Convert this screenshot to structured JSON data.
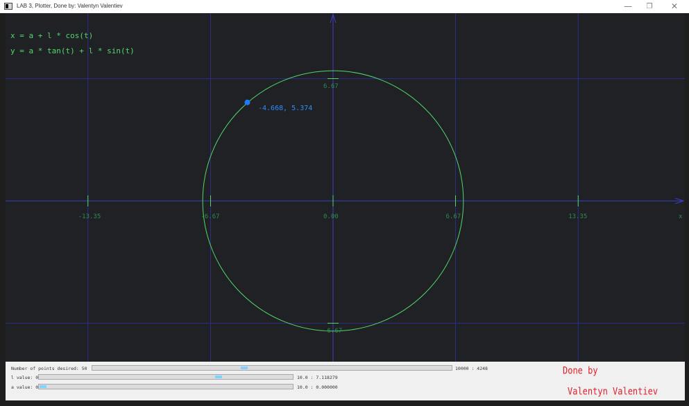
{
  "window": {
    "title": "LAB 3, Plotter, Done by: Valentyn Valentiev",
    "minimize_glyph": "—",
    "maximize_glyph": "❐",
    "close_glyph": "✕"
  },
  "plot": {
    "formula_x": "x = a + l * cos(t)",
    "formula_y": "y = a * tan(t) + l * sin(t)",
    "point_label": "-4.668, 5.374",
    "x_ticks": [
      "-13.35",
      "-6.67",
      "0.00",
      "6.67",
      "13.35"
    ],
    "y_ticks": [
      "6.67",
      "-6.67"
    ],
    "x_axis_name": "x",
    "colors": {
      "background": "#202124",
      "grid": "#2c2c8a",
      "axis": "#3d3dc4",
      "curve": "#52d86a",
      "point": "#1e7bff",
      "tick_label": "#2f8a50"
    }
  },
  "chart_data": {
    "type": "line",
    "curve": "parametric circle",
    "x_range": [
      -20.0,
      20.0
    ],
    "y_range": [
      -11.4,
      11.4
    ],
    "x_ticks": [
      -13.35,
      -6.67,
      0.0,
      6.67,
      13.35
    ],
    "y_ticks": [
      6.67,
      -6.67
    ],
    "center": [
      0,
      0
    ],
    "radius": 7.1,
    "highlight_point": {
      "x": -4.668,
      "y": 5.374
    },
    "grid": true
  },
  "controls": {
    "points": {
      "label": "Number of points desired: 50",
      "value": "10000 : 4248",
      "level": 0.42
    },
    "l_value": {
      "label": "l value: 0",
      "value": "10.0 : 7.118279",
      "level": 0.71
    },
    "a_value": {
      "label": "a value: 0",
      "value": "10.0 : 0.000000",
      "level": 0.0
    }
  },
  "footer": {
    "done_by": "Done by",
    "author": "Valentyn Valentiev"
  }
}
